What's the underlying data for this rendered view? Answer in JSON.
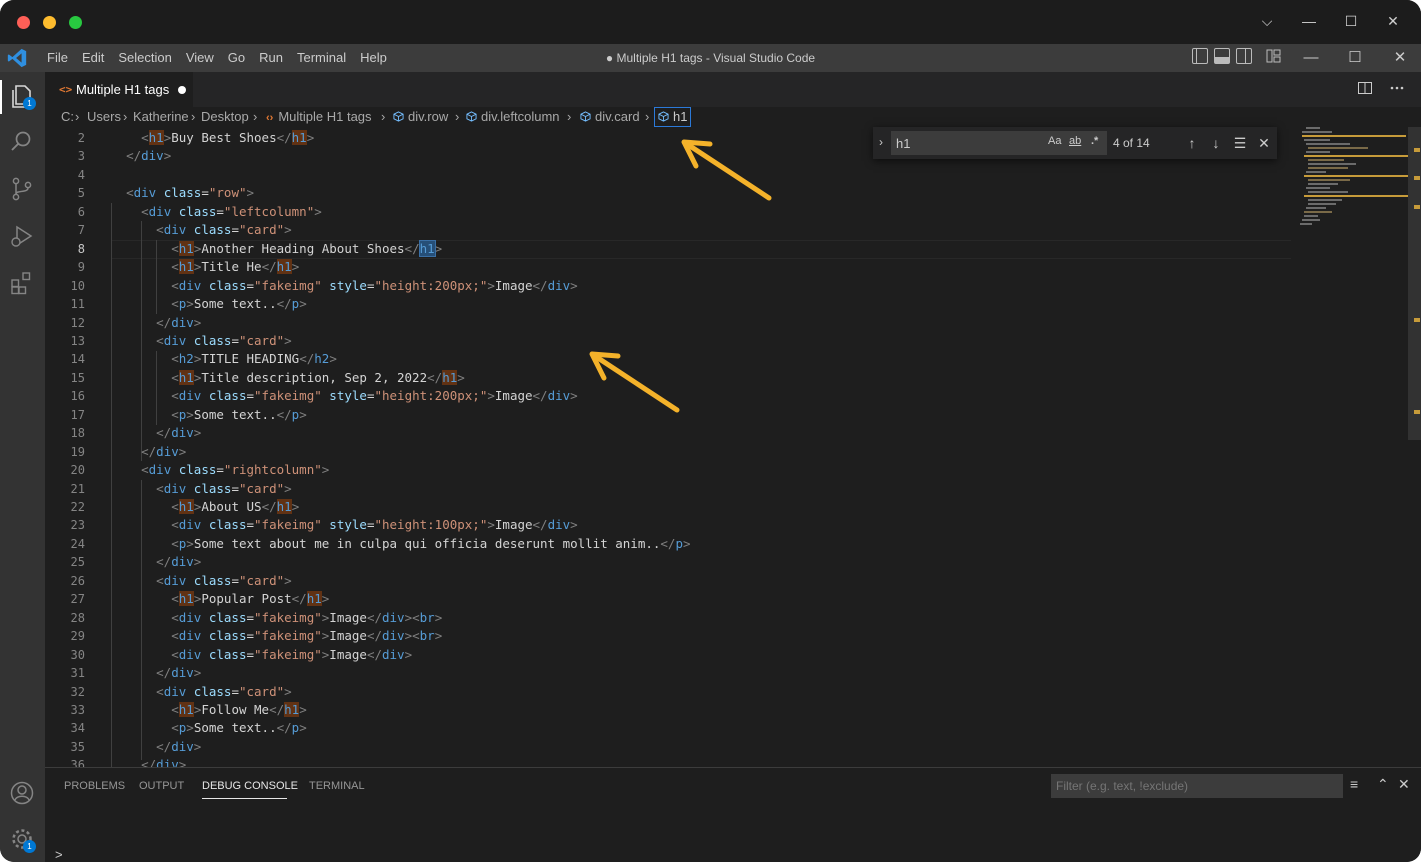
{
  "window": {
    "title": "● Multiple H1 tags - Visual Studio Code",
    "system_controls": {
      "chevron": "⌵",
      "minimize": "—",
      "maximize": "☐",
      "close": "✕"
    }
  },
  "menu": [
    "File",
    "Edit",
    "Selection",
    "View",
    "Go",
    "Run",
    "Terminal",
    "Help"
  ],
  "activity_bar": {
    "explorer_badge": "1",
    "settings_badge": "1"
  },
  "tab": {
    "label": "Multiple H1 tags",
    "icon": "<>"
  },
  "breadcrumb": [
    "C:",
    "Users",
    "Katherine",
    "Desktop",
    "Multiple H1 tags",
    "div.row",
    "div.leftcolumn",
    "div.card",
    "h1"
  ],
  "find_widget": {
    "query": "h1",
    "opt_case": "Aa",
    "opt_word": "ab",
    "opt_regex": ".*",
    "count": "4 of 14"
  },
  "editor": {
    "active_line": "8",
    "line_numbers": [
      "2",
      "3",
      "4",
      "5",
      "6",
      "7",
      "8",
      "9",
      "10",
      "11",
      "12",
      "13",
      "14",
      "15",
      "16",
      "17",
      "18",
      "19",
      "20",
      "21",
      "22",
      "23",
      "24",
      "25",
      "26",
      "27",
      "28",
      "29",
      "30",
      "31",
      "32",
      "33",
      "34",
      "35",
      "36"
    ]
  },
  "panel": {
    "tabs": [
      "PROBLEMS",
      "OUTPUT",
      "DEBUG CONSOLE",
      "TERMINAL"
    ],
    "active_tab": "DEBUG CONSOLE",
    "filter_placeholder": "Filter (e.g. text, !exclude)",
    "prompt": ">"
  },
  "colors": {
    "accent": "#0078d4",
    "arrow": "#f4b22a",
    "match_highlight": "#613214",
    "current_match": "#264f78"
  }
}
